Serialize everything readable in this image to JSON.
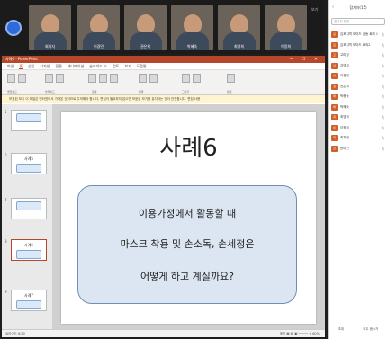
{
  "video": {
    "top_right_label": "보기",
    "tiles": [
      {
        "name": "회의자"
      },
      {
        "name": "이경민"
      },
      {
        "name": "권은희"
      },
      {
        "name": "박혜숙"
      },
      {
        "name": "최영희"
      },
      {
        "name": "이정희"
      }
    ]
  },
  "ppt": {
    "title": "사례6 - PowerPoint",
    "tabs": [
      "파일",
      "홈",
      "삽입",
      "디자인",
      "전환",
      "애니메이션",
      "슬라이드 쇼",
      "검토",
      "보기",
      "도움말"
    ],
    "active_tab": "홈",
    "ribbon_groups": [
      "클립보드",
      "슬라이드",
      "글꼴",
      "단락",
      "그리기",
      "편집"
    ],
    "notice": "보호된 보기  이 파일은 인터넷에서 가져온 것이므로 주의해야 합니다. 편집이 필요하지 않으면 보호된 보기를 유지하는 것이 안전합니다.  편집 사용",
    "thumbnails": [
      {
        "num": "5",
        "title": ""
      },
      {
        "num": "6",
        "title": "사례5"
      },
      {
        "num": "7",
        "title": ""
      },
      {
        "num": "8",
        "title": "사례6"
      },
      {
        "num": "9",
        "title": "사례7"
      }
    ],
    "slide": {
      "title": "사례6",
      "lines": [
        "이용가정에서 활동할 때",
        "마스크 착용 및 손소독, 손세정은",
        "어떻게 하고 계실까요?"
      ]
    },
    "status": "슬라이드 8/20",
    "zoom": "메모   ▦  ▤  ▣   ─────  +  60%"
  },
  "panel": {
    "title": "참가자(15)",
    "search_placeholder": "참가자 찾기",
    "participants": [
      {
        "initial": "김",
        "name": "김포지역 보이드 공동 회의 사"
      },
      {
        "initial": "김",
        "name": "김포지역 보이드 회의2"
      },
      {
        "initial": "고",
        "name": "고미정"
      },
      {
        "initial": "강",
        "name": "강영희"
      },
      {
        "initial": "이",
        "name": "이경민"
      },
      {
        "initial": "권",
        "name": "권은희"
      },
      {
        "initial": "박",
        "name": "박종숙"
      },
      {
        "initial": "박",
        "name": "박혜숙"
      },
      {
        "initial": "최",
        "name": "최영희"
      },
      {
        "initial": "이",
        "name": "이정희"
      },
      {
        "initial": "최",
        "name": "최지영"
      },
      {
        "initial": "한",
        "name": "한미선"
      }
    ],
    "footer_invite": "초대",
    "footer_mute": "모두 음소거"
  }
}
